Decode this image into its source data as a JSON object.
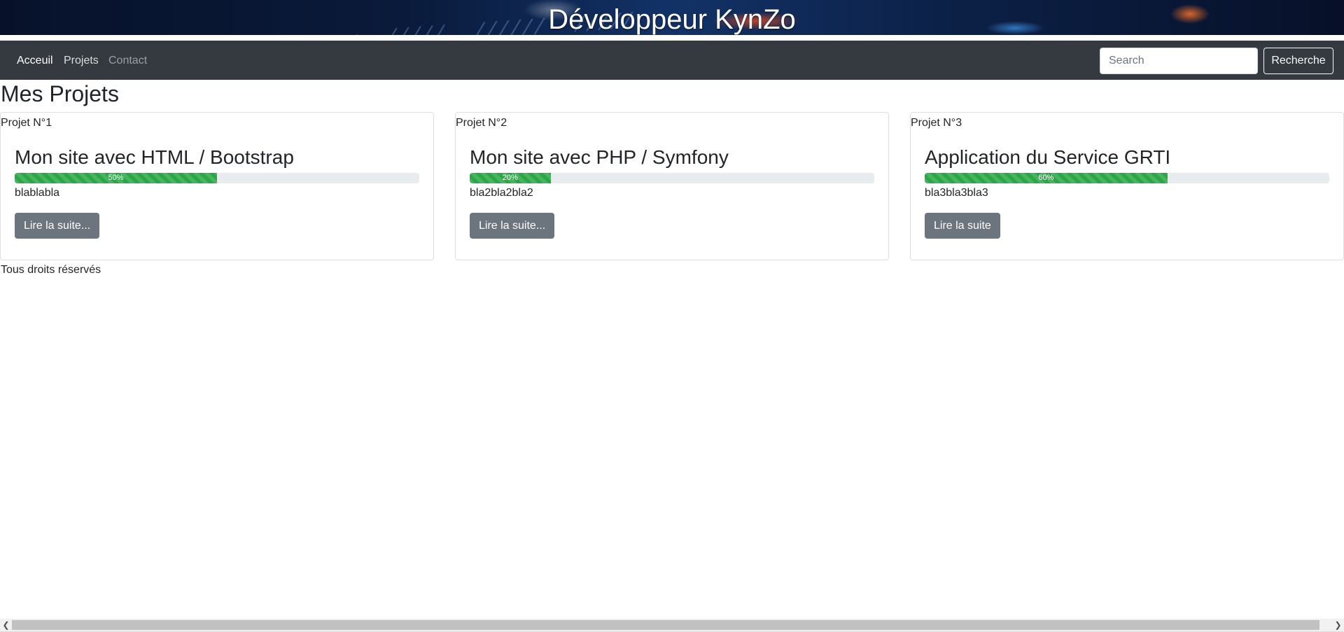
{
  "header": {
    "title": "Développeur KynZo"
  },
  "navbar": {
    "links": [
      {
        "label": "Acceuil"
      },
      {
        "label": "Projets"
      },
      {
        "label": "Contact"
      }
    ],
    "search": {
      "placeholder": "Search",
      "value": ""
    },
    "search_button": "Recherche"
  },
  "main": {
    "heading": "Mes Projets",
    "projects": [
      {
        "header": "Projet N°1",
        "title": "Mon site avec HTML / Bootstrap",
        "progress_label": "50%",
        "progress": 0.5,
        "text": "blablabla",
        "button": "Lire la suite..."
      },
      {
        "header": "Projet N°2",
        "title": "Mon site avec PHP / Symfony",
        "progress_label": "20%",
        "progress": 0.2,
        "text": "bla2bla2bla2",
        "button": "Lire la suite..."
      },
      {
        "header": "Projet N°3",
        "title": "Application du Service GRTI",
        "progress_label": "60%",
        "progress": 0.6,
        "text": "bla3bla3bla3",
        "button": "Lire la suite"
      }
    ]
  },
  "footer": {
    "text": "Tous droits réservés"
  },
  "colors": {
    "navbar": "#343a40",
    "progress": "#28a745",
    "button": "#6c757d"
  },
  "icons": {
    "scroll_left": "chevron-left-icon",
    "scroll_right": "chevron-right-icon"
  }
}
